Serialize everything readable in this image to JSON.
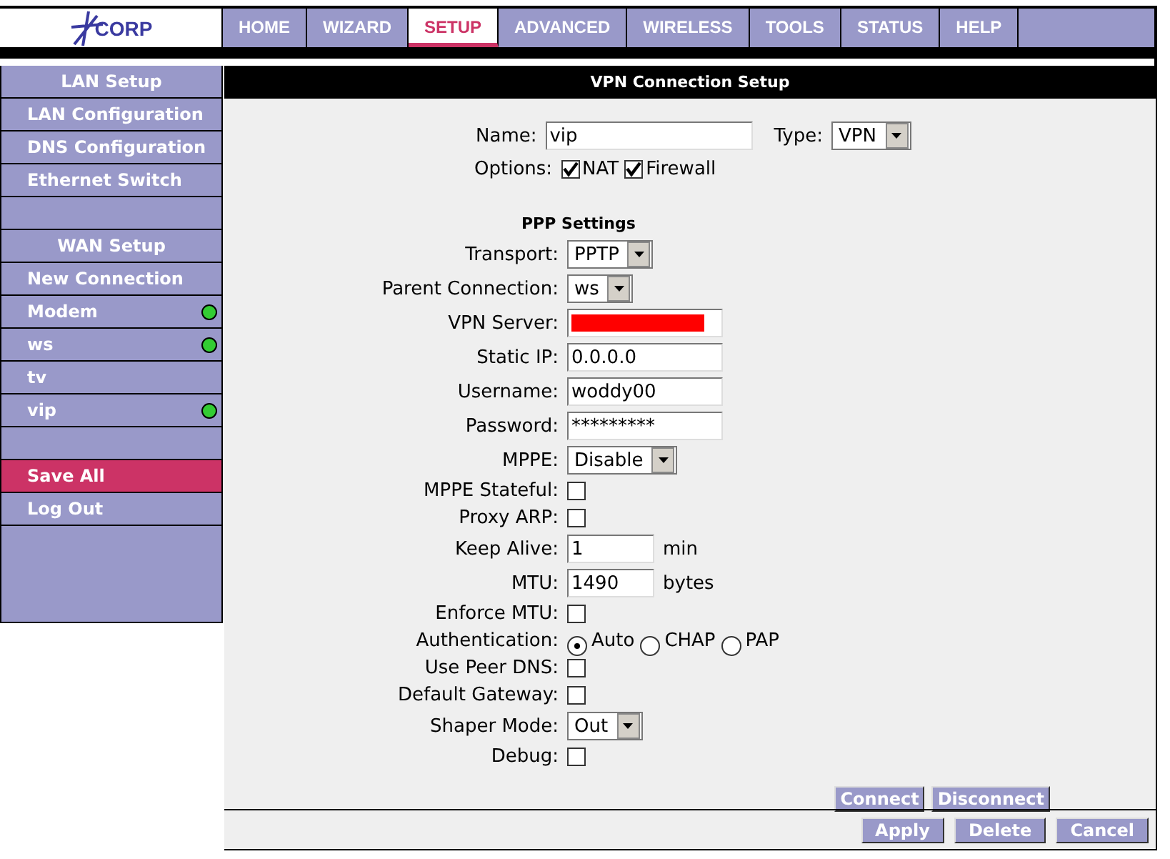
{
  "nav": [
    {
      "label": "HOME",
      "selected": false
    },
    {
      "label": "WIZARD",
      "selected": false
    },
    {
      "label": "SETUP",
      "selected": true
    },
    {
      "label": "ADVANCED",
      "selected": false
    },
    {
      "label": "WIRELESS",
      "selected": false
    },
    {
      "label": "TOOLS",
      "selected": false
    },
    {
      "label": "STATUS",
      "selected": false
    },
    {
      "label": "HELP",
      "selected": false
    }
  ],
  "logo": "CORP",
  "sidebar": [
    {
      "kind": "header",
      "label": "LAN Setup"
    },
    {
      "kind": "link",
      "label": "LAN Configuration",
      "online": false,
      "selected": false
    },
    {
      "kind": "link",
      "label": "DNS Configuration",
      "online": false,
      "selected": false
    },
    {
      "kind": "link",
      "label": "Ethernet Switch",
      "online": false,
      "selected": false
    },
    {
      "kind": "blank"
    },
    {
      "kind": "header",
      "label": "WAN Setup"
    },
    {
      "kind": "link",
      "label": "New Connection",
      "online": false,
      "selected": false
    },
    {
      "kind": "link",
      "label": "Modem",
      "online": true,
      "selected": false
    },
    {
      "kind": "link",
      "label": "ws",
      "online": true,
      "selected": false
    },
    {
      "kind": "link",
      "label": "tv",
      "online": false,
      "selected": false
    },
    {
      "kind": "link",
      "label": "vip",
      "online": true,
      "selected": false
    },
    {
      "kind": "blank"
    },
    {
      "kind": "link",
      "label": "Save All",
      "online": false,
      "selected": true
    },
    {
      "kind": "link",
      "label": "Log Out",
      "online": false,
      "selected": false
    }
  ],
  "panel_title": "VPN Connection Setup",
  "name": {
    "label": "Name:",
    "value": "vip"
  },
  "type": {
    "label": "Type:",
    "value": "VPN"
  },
  "options": {
    "label": "Options:",
    "items": [
      {
        "label": "NAT",
        "checked": true
      },
      {
        "label": "Firewall",
        "checked": true
      }
    ]
  },
  "section_title": "PPP Settings",
  "fields": [
    {
      "kind": "select",
      "label": "Transport:",
      "value": "PPTP"
    },
    {
      "kind": "select",
      "label": "Parent Connection:",
      "value": "ws"
    },
    {
      "kind": "redacted",
      "label": "VPN Server:"
    },
    {
      "kind": "text",
      "label": "Static IP:",
      "value": "0.0.0.0"
    },
    {
      "kind": "text",
      "label": "Username:",
      "value": "woddy00"
    },
    {
      "kind": "text",
      "label": "Password:",
      "value": "*********"
    },
    {
      "kind": "select",
      "label": "MPPE:",
      "value": "Disable"
    },
    {
      "kind": "checkbox",
      "label": "MPPE Stateful:",
      "checked": false
    },
    {
      "kind": "checkbox",
      "label": "Proxy ARP:",
      "checked": false
    },
    {
      "kind": "short",
      "label": "Keep Alive:",
      "value": "1",
      "unit": "min"
    },
    {
      "kind": "short",
      "label": "MTU:",
      "value": "1490",
      "unit": "bytes"
    },
    {
      "kind": "checkbox",
      "label": "Enforce MTU:",
      "checked": false
    },
    {
      "kind": "radio",
      "label": "Authentication:",
      "options": [
        {
          "label": "Auto",
          "selected": true
        },
        {
          "label": "CHAP",
          "selected": false
        },
        {
          "label": "PAP",
          "selected": false
        }
      ]
    },
    {
      "kind": "checkbox",
      "label": "Use Peer DNS:",
      "checked": false
    },
    {
      "kind": "checkbox",
      "label": "Default Gateway:",
      "checked": false
    },
    {
      "kind": "select",
      "label": "Shaper Mode:",
      "value": "Out"
    },
    {
      "kind": "checkbox",
      "label": "Debug:",
      "checked": false
    }
  ],
  "connection_buttons": [
    "Connect",
    "Disconnect"
  ],
  "footer_buttons": [
    "Apply",
    "Delete",
    "Cancel"
  ]
}
